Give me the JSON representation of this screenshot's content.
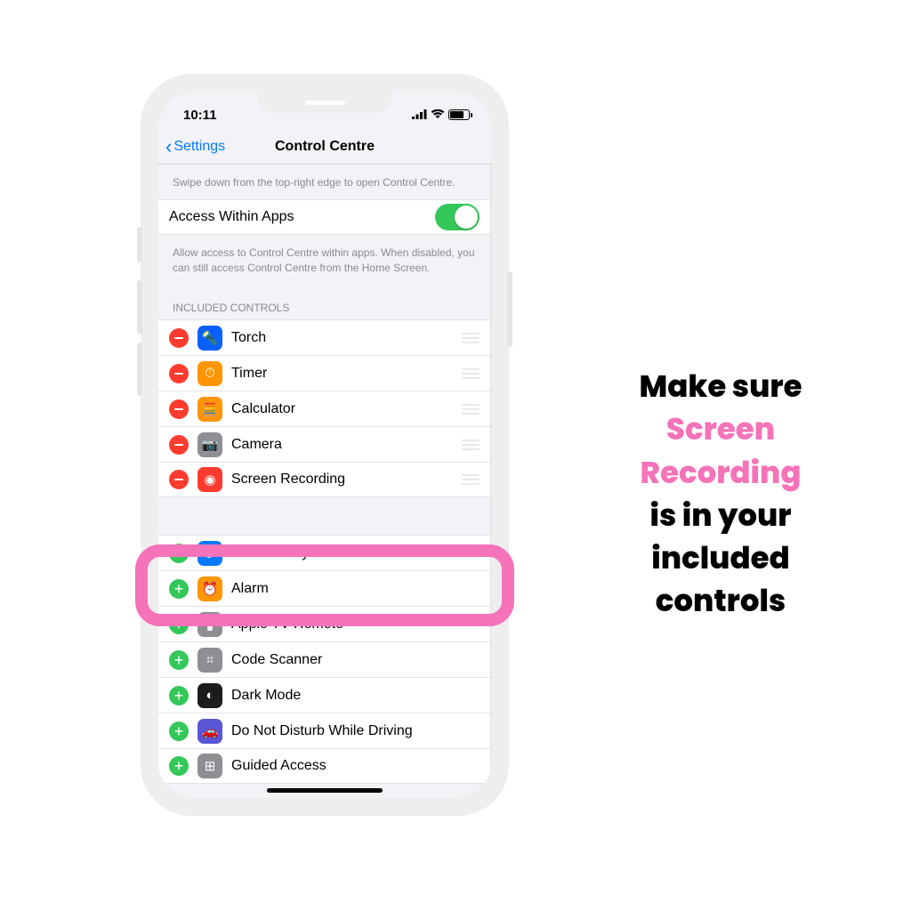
{
  "status": {
    "time": "10:11"
  },
  "nav": {
    "back_label": "Settings",
    "title": "Control Centre"
  },
  "hint1": "Swipe down from the top-right edge to open Control Centre.",
  "access_row": {
    "label": "Access Within Apps"
  },
  "hint2": "Allow access to Control Centre within apps. When disabled, you can still access Control Centre from the Home Screen.",
  "included_header": "Included Controls",
  "included": [
    {
      "label": "Torch",
      "icon_bg": "#0a60ff",
      "glyph": "🔦"
    },
    {
      "label": "Timer",
      "icon_bg": "#ff9500",
      "glyph": "⏱"
    },
    {
      "label": "Calculator",
      "icon_bg": "#ff9500",
      "glyph": "🧮"
    },
    {
      "label": "Camera",
      "icon_bg": "#8e8e93",
      "glyph": "📷"
    },
    {
      "label": "Screen Recording",
      "icon_bg": "#ff3b30",
      "glyph": "◉"
    }
  ],
  "more": [
    {
      "label": "Accessibility Shortcuts",
      "icon_bg": "#007aff",
      "glyph": "♿︎"
    },
    {
      "label": "Alarm",
      "icon_bg": "#ff9500",
      "glyph": "⏰"
    },
    {
      "label": "Apple TV Remote",
      "icon_bg": "#8e8e93",
      "glyph": "▮"
    },
    {
      "label": "Code Scanner",
      "icon_bg": "#8e8e93",
      "glyph": "⌗"
    },
    {
      "label": "Dark Mode",
      "icon_bg": "#1c1c1e",
      "glyph": "◐"
    },
    {
      "label": "Do Not Disturb While Driving",
      "icon_bg": "#5856d6",
      "glyph": "🚗"
    },
    {
      "label": "Guided Access",
      "icon_bg": "#8e8e93",
      "glyph": "⊞"
    }
  ],
  "callout": {
    "line1": "Make sure",
    "screen": "Screen",
    "recording": "Recording",
    "line4": "is in your",
    "line5": "included",
    "line6": "controls"
  }
}
